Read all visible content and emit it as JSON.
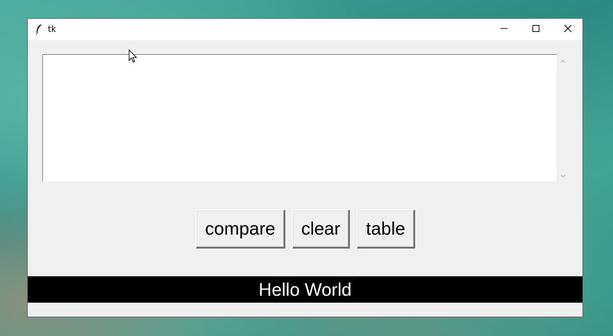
{
  "window": {
    "title": "tk"
  },
  "text_area": {
    "value": ""
  },
  "buttons": {
    "compare_label": "compare",
    "clear_label": "clear",
    "table_label": "table"
  },
  "status": {
    "text": "Hello World"
  },
  "icons": {
    "app": "tk-feather-icon",
    "minimize": "minimize-icon",
    "maximize": "maximize-icon",
    "close": "close-icon",
    "scroll_up": "chevron-up-icon",
    "scroll_down": "chevron-down-icon"
  },
  "colors": {
    "status_background": "#000000",
    "status_text": "#ffffff",
    "window_background": "#f0f0f0"
  }
}
